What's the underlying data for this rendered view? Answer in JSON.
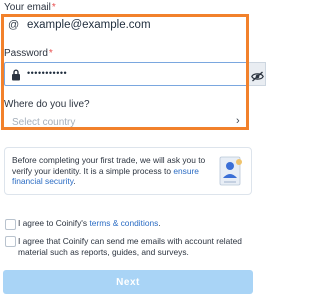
{
  "form": {
    "email": {
      "label": "Your email",
      "required_mark": "*",
      "prefix_symbol": "@",
      "value": "example@example.com"
    },
    "password": {
      "label": "Password",
      "required_mark": "*",
      "masked_value": "•••••••••••"
    },
    "country": {
      "label": "Where do you live?",
      "placeholder": "Select country"
    }
  },
  "info": {
    "text_before": "Before completing your first trade, we will ask you to verify your identity. It is a simple process to ",
    "link": "ensure financial security",
    "text_after": "."
  },
  "terms": {
    "prefix": "I agree to Coinify's ",
    "link": "terms & conditions",
    "suffix": "."
  },
  "emails_consent": {
    "text": "I agree that Coinify can send me emails with account related material such as reports, guides, and surveys."
  },
  "next_button": {
    "label": "Next"
  },
  "colors": {
    "highlight": "#f2812b",
    "link": "#2b6cc4",
    "button": "#a9d4f6"
  }
}
